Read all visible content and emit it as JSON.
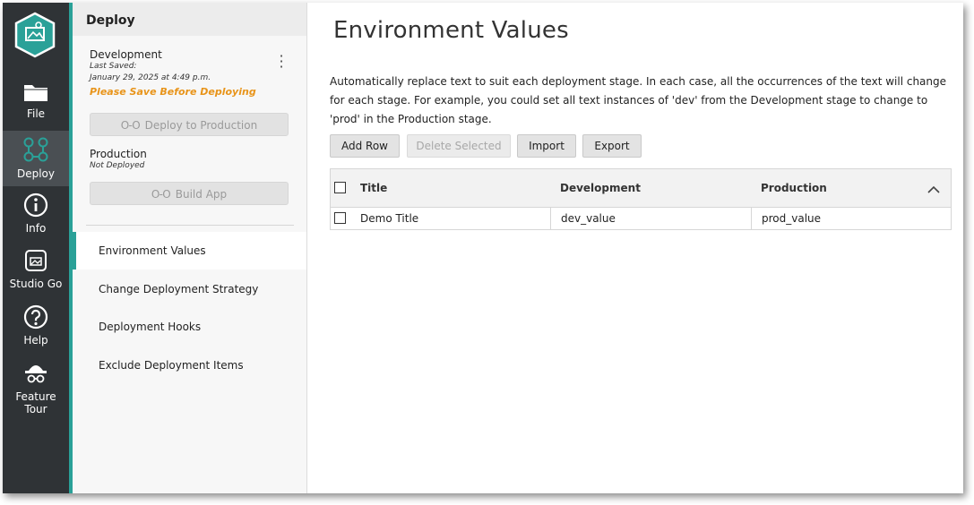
{
  "rail": {
    "items": [
      {
        "label": "File",
        "icon": "folder-icon"
      },
      {
        "label": "Deploy",
        "icon": "deploy-nodes-icon"
      },
      {
        "label": "Info",
        "icon": "info-icon"
      },
      {
        "label": "Studio Go",
        "icon": "studio-go-icon"
      },
      {
        "label": "Help",
        "icon": "help-icon"
      },
      {
        "label": "Feature Tour",
        "icon": "feature-tour-icon"
      }
    ],
    "active": "Deploy",
    "accent": "#2aa198"
  },
  "panel": {
    "header": "Deploy",
    "development": {
      "name": "Development",
      "last_saved_label": "Last Saved:",
      "last_saved_value": "January 29, 2025 at 4:49 p.m.",
      "warning": "Please Save Before Deploying",
      "deploy_button": "Deploy to Production"
    },
    "production": {
      "name": "Production",
      "status": "Not Deployed",
      "build_button": "Build App"
    },
    "nav": [
      {
        "label": "Environment Values",
        "active": true
      },
      {
        "label": "Change Deployment Strategy"
      },
      {
        "label": "Deployment Hooks"
      },
      {
        "label": "Exclude Deployment Items"
      }
    ]
  },
  "main": {
    "title": "Environment Values",
    "description": "Automatically replace text to suit each deployment stage. In each case, all the occurrences of the text will change for each stage. For example, you could set all text instances of 'dev' from the Development stage to change to 'prod' in the Production stage.",
    "toolbar": {
      "add_row": "Add Row",
      "delete_selected": "Delete Selected",
      "import": "Import",
      "export": "Export"
    },
    "table": {
      "columns": [
        "Title",
        "Development",
        "Production"
      ],
      "rows": [
        [
          "Demo Title",
          "dev_value",
          "prod_value"
        ]
      ]
    }
  }
}
